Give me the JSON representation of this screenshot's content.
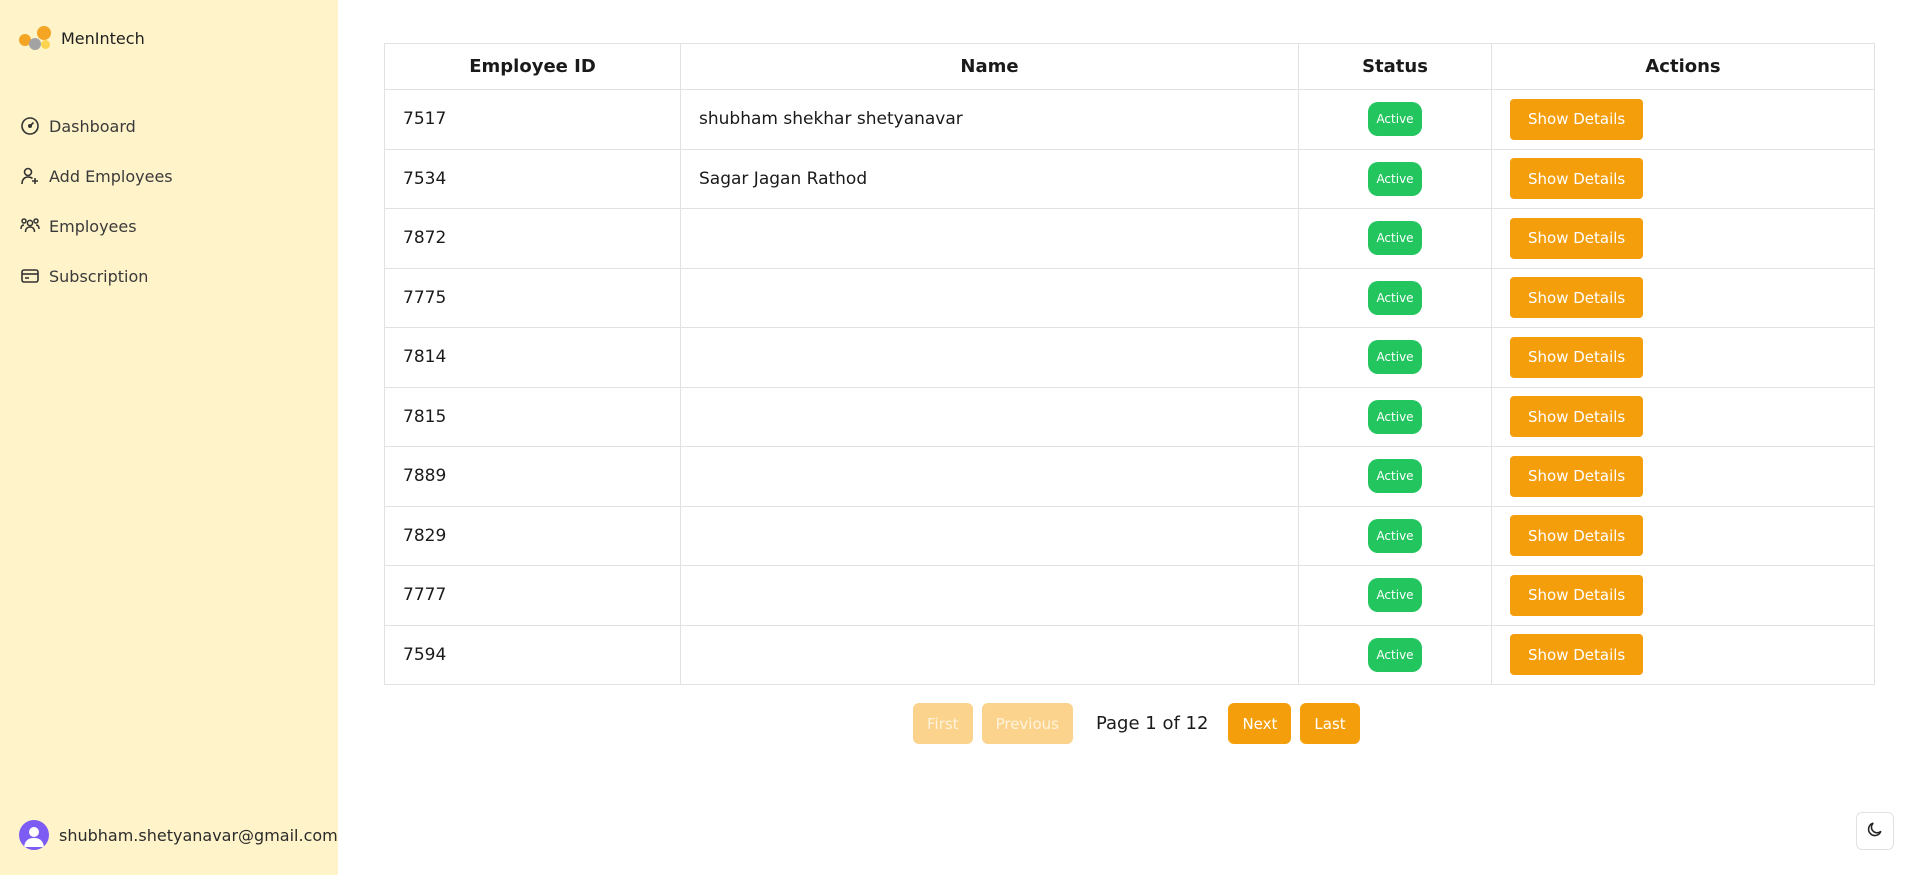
{
  "brand": {
    "name": "MenIntech",
    "logo_colors": [
      "#f5a524",
      "#fcd34d",
      "#a3a3a3"
    ]
  },
  "nav": [
    {
      "label": "Dashboard",
      "icon": "dashboard-icon"
    },
    {
      "label": "Add Employees",
      "icon": "add-user-icon"
    },
    {
      "label": "Employees",
      "icon": "users-icon"
    },
    {
      "label": "Subscription",
      "icon": "credit-card-icon"
    }
  ],
  "user": {
    "email": "shubham.shetyanavar@gmail.com",
    "avatar_color": "#7c5cf2"
  },
  "table": {
    "headers": {
      "id": "Employee ID",
      "name": "Name",
      "status": "Status",
      "actions": "Actions"
    },
    "rows": [
      {
        "id": "7517",
        "name": "shubham shekhar shetyanavar",
        "status": "Active",
        "action": "Show Details"
      },
      {
        "id": "7534",
        "name": "Sagar Jagan Rathod",
        "status": "Active",
        "action": "Show Details"
      },
      {
        "id": "7872",
        "name": "",
        "status": "Active",
        "action": "Show Details"
      },
      {
        "id": "7775",
        "name": "",
        "status": "Active",
        "action": "Show Details"
      },
      {
        "id": "7814",
        "name": "",
        "status": "Active",
        "action": "Show Details"
      },
      {
        "id": "7815",
        "name": "",
        "status": "Active",
        "action": "Show Details"
      },
      {
        "id": "7889",
        "name": "",
        "status": "Active",
        "action": "Show Details"
      },
      {
        "id": "7829",
        "name": "",
        "status": "Active",
        "action": "Show Details"
      },
      {
        "id": "7777",
        "name": "",
        "status": "Active",
        "action": "Show Details"
      },
      {
        "id": "7594",
        "name": "",
        "status": "Active",
        "action": "Show Details"
      }
    ]
  },
  "pagination": {
    "first": "First",
    "previous": "Previous",
    "info": "Page 1 of 12",
    "next": "Next",
    "last": "Last"
  },
  "theme_toggle": {
    "icon": "moon-icon"
  },
  "colors": {
    "sidebar_bg": "#fff3c9",
    "accent": "#f59e0b",
    "active_badge": "#22c55e"
  }
}
